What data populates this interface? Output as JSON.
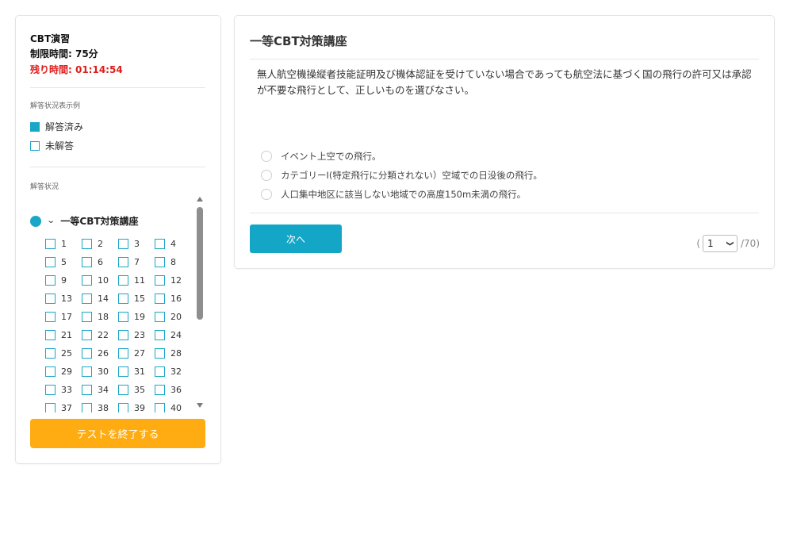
{
  "sidebar": {
    "exam_title": "CBT演習",
    "time_limit": "制限時間: 75分",
    "time_remaining": "残り時間: 01:14:54",
    "legend_heading": "解答状況表示例",
    "legend_answered": "解答済み",
    "legend_unanswered": "未解答",
    "status_heading": "解答状況",
    "section_name": "一等CBT対策講座",
    "question_numbers": [
      "1",
      "2",
      "3",
      "4",
      "5",
      "6",
      "7",
      "8",
      "9",
      "10",
      "11",
      "12",
      "13",
      "14",
      "15",
      "16",
      "17",
      "18",
      "19",
      "20",
      "21",
      "22",
      "23",
      "24",
      "25",
      "26",
      "27",
      "28",
      "29",
      "30",
      "31",
      "32",
      "33",
      "34",
      "35",
      "36",
      "37",
      "38",
      "39",
      "40"
    ],
    "end_button": "テストを終了する"
  },
  "main": {
    "course_title": "一等CBT対策講座",
    "question_text": "無人航空機操縦者技能証明及び機体認証を受けていない場合であっても航空法に基づく国の飛行の許可又は承認が不要な飛行として、正しいものを選びなさい。",
    "options": [
      "イベント上空での飛行。",
      "カテゴリーⅠ(特定飛行に分類されない）空域での日没後の飛行。",
      "人口集中地区に該当しない地域での高度150m未満の飛行。"
    ],
    "next_button": "次へ",
    "pager_open": "(",
    "current_page": "1",
    "pager_total": "/70)"
  },
  "colors": {
    "accent": "#1aa6c6",
    "warning_text": "#e01b1b",
    "end_button": "#ffac12"
  }
}
